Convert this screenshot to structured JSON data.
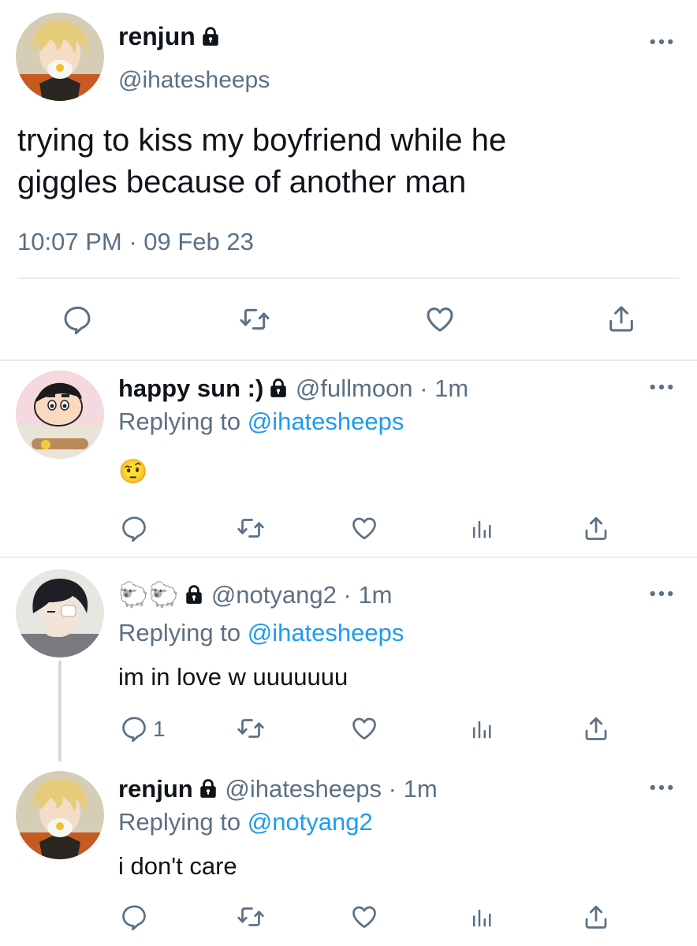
{
  "main_tweet": {
    "display_name": "renjun",
    "handle": "@ihatesheeps",
    "text_line1": "trying to kiss my boyfriend while he",
    "text_line2": "giggles because of another man",
    "time": "10:07 PM",
    "separator": "·",
    "date": "09 Feb 23",
    "avatar_icon": "anime-avatar-blond-mask",
    "actions": [
      "reply-icon",
      "retweet-icon",
      "like-icon",
      "share-icon"
    ]
  },
  "replies": [
    {
      "display_name": "happy sun :)",
      "handle": "@fullmoon",
      "sep": "·",
      "time": "1m",
      "replying_to_label": "Replying to",
      "replying_to_handle": "@ihatesheeps",
      "text": "🤨",
      "reply_count": "",
      "avatar_icon": "cartoon-avatar-shinchan"
    },
    {
      "display_name": "🐑🐑",
      "handle": "@notyang2",
      "sep": "·",
      "time": "1m",
      "replying_to_label": "Replying to",
      "replying_to_handle": "@ihatesheeps",
      "text": "im in love w uuuuuuu",
      "reply_count": "1",
      "avatar_icon": "anime-avatar-dark-hair"
    },
    {
      "display_name": "renjun",
      "handle": "@ihatesheeps",
      "sep": "·",
      "time": "1m",
      "replying_to_label": "Replying to",
      "replying_to_handle": "@notyang2",
      "text": "i don't care",
      "reply_count": "",
      "avatar_icon": "anime-avatar-blond-mask"
    }
  ],
  "colors": {
    "accent": "#1d9bf0",
    "muted": "#5b7083",
    "text": "#0f1419",
    "divider": "#e6ecf0"
  }
}
